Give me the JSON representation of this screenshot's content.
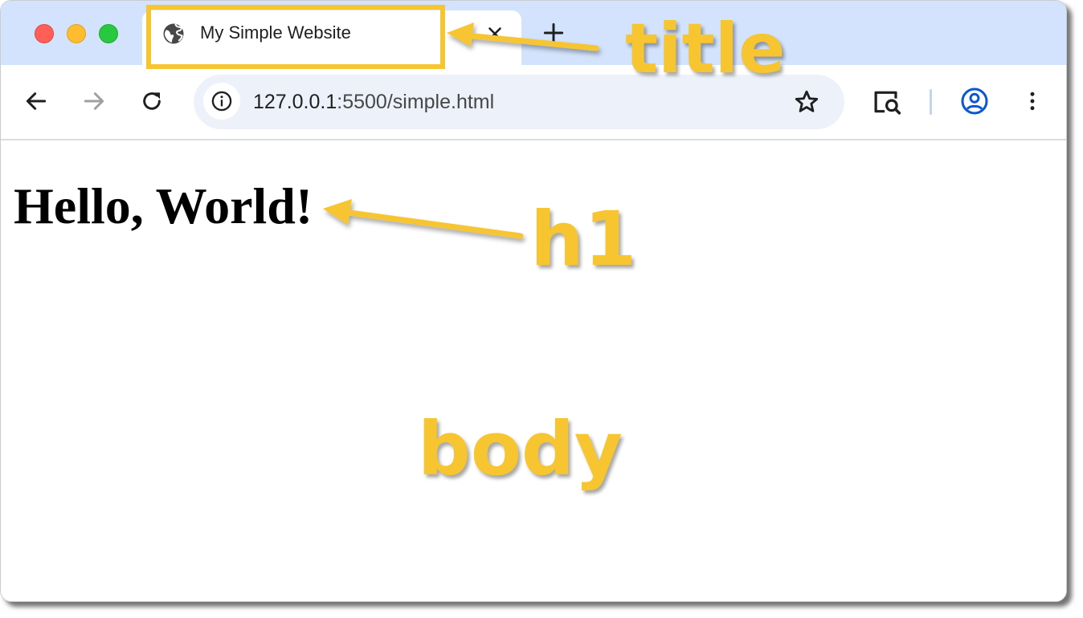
{
  "browser": {
    "tab": {
      "title": "My Simple Website",
      "favicon": "globe-icon"
    },
    "new_tab_label": "+",
    "address": {
      "host": "127.0.0.1",
      "path": ":5500/simple.html"
    },
    "colors": {
      "tabstrip": "#d3e3fd",
      "omnibox": "#edf2fa",
      "traffic_close": "#ff5f57",
      "traffic_minimize": "#febc2e",
      "traffic_maximize": "#28c840",
      "profile_accent": "#0b57d0"
    },
    "toolbar_icons": [
      "back-arrow-icon",
      "forward-arrow-icon",
      "reload-icon",
      "info-icon",
      "star-icon",
      "lens-search-icon",
      "profile-icon",
      "more-vert-icon"
    ]
  },
  "page": {
    "heading": "Hello, World!"
  },
  "annotations": {
    "color": "#f7c530",
    "title_label": "title",
    "h1_label": "h1",
    "body_label": "body"
  }
}
